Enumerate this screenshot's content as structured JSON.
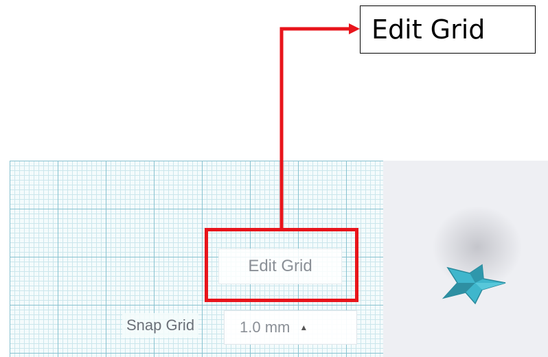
{
  "callout": {
    "label": "Edit Grid"
  },
  "workplane": {
    "edit_grid_label": "Edit Grid",
    "snap_grid_label": "Snap Grid",
    "snap_grid_value": "1.0 mm",
    "snap_arrow_glyph": "▲"
  },
  "colors": {
    "highlight": "#e8141b",
    "grid_major": "#88c2d0",
    "grid_minor": "#cbe6ec",
    "star": "#3fb6cc"
  },
  "icons": {
    "star": "star-icon",
    "dropdown": "caret-up-icon"
  }
}
